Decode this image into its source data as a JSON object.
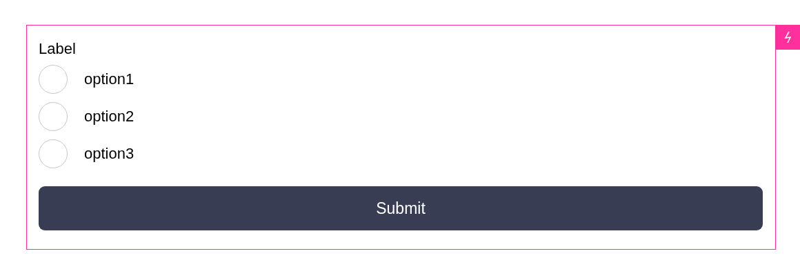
{
  "form": {
    "label": "Label",
    "options": [
      {
        "label": "option1",
        "selected": false
      },
      {
        "label": "option2",
        "selected": false
      },
      {
        "label": "option3",
        "selected": false
      }
    ],
    "submit": "Submit"
  }
}
